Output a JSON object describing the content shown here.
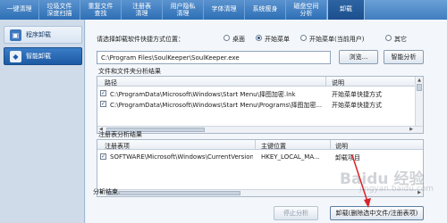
{
  "tabs": [
    {
      "label": "一键清理"
    },
    {
      "label": "垃圾文件\n深度扫描"
    },
    {
      "label": "重复文件\n查找"
    },
    {
      "label": "注册表\n清理"
    },
    {
      "label": "用户隐私\n清理"
    },
    {
      "label": "字体清理"
    },
    {
      "label": "系统瘦身"
    },
    {
      "label": "磁盘空间\n分析"
    },
    {
      "label": "卸载"
    }
  ],
  "sidebar": {
    "items": [
      {
        "label": "程序卸载",
        "icon": "program-uninstall-icon"
      },
      {
        "label": "智能卸载",
        "icon": "smart-uninstall-icon"
      }
    ]
  },
  "shortcut": {
    "prompt": "请选择卸载软件快捷方式位置：",
    "options": [
      {
        "label": "桌面",
        "selected": false
      },
      {
        "label": "开始菜单",
        "selected": true
      },
      {
        "label": "开始菜单(当前用户)",
        "selected": false
      },
      {
        "label": "其它",
        "selected": false
      }
    ]
  },
  "path": {
    "value": "C:\\Program Files\\SoulKeeper\\SoulKeeper.exe"
  },
  "buttons": {
    "browse": "浏览...",
    "smart_analyze": "智能分析",
    "stop_analyze": "停止分析",
    "uninstall": "卸载(删除选中文件/注册表项)"
  },
  "files_group": {
    "title": "文件和文件夹分析结果",
    "columns": [
      "路径",
      "说明"
    ],
    "rows": [
      {
        "checked": true,
        "path": "C:\\ProgramData\\Microsoft\\Windows\\Start Menu\\择图加密.lnk",
        "desc": "开始菜单快捷方式"
      },
      {
        "checked": true,
        "path": "C:\\ProgramData\\Microsoft\\Windows\\Start Menu\\Programs\\择图加密...",
        "desc": "开始菜单快捷方式"
      }
    ]
  },
  "registry_group": {
    "title": "注册表分析结果",
    "columns": [
      "注册表项",
      "主键位置",
      "说明"
    ],
    "rows": [
      {
        "checked": true,
        "key": "SOFTWARE\\Microsoft\\Windows\\CurrentVersion...",
        "hive": "HKEY_LOCAL_MA...",
        "desc": "卸载项目"
      }
    ]
  },
  "status": "分析结束.",
  "watermark": {
    "text": "Baidu 经验",
    "sub": "jingyan.baidu.com"
  },
  "colors": {
    "tab_bar": "#2d6fb5",
    "active_nav": "#1c5aa3",
    "arrow": "#d8232a"
  }
}
